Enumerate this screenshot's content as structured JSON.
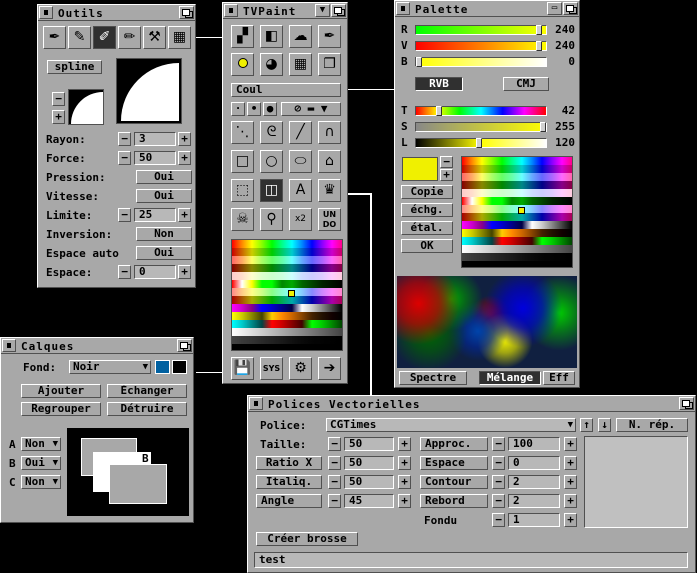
{
  "outils": {
    "title": "Outils",
    "spline": "spline",
    "rayon_label": "Rayon:",
    "rayon_value": "3",
    "force_label": "Force:",
    "force_value": "50",
    "pression_label": "Pression:",
    "pression_value": "Oui",
    "vitesse_label": "Vitesse:",
    "vitesse_value": "Oui",
    "limite_label": "Limite:",
    "limite_value": "25",
    "inversion_label": "Inversion:",
    "inversion_value": "Non",
    "espace_auto_label": "Espace auto",
    "espace_auto_value": "Oui",
    "espace_label": "Espace:",
    "espace_value": "0",
    "minus": "−",
    "plus": "+",
    "plus_small": "+",
    "minus_small": "−"
  },
  "tvpaint": {
    "title": "TVPaint",
    "coul": "Coul",
    "undo": "UN DO",
    "sys": "SYS"
  },
  "palette": {
    "title": "Palette",
    "r_label": "R",
    "r_value": "240",
    "v_label": "V",
    "v_value": "240",
    "b_label": "B",
    "b_value": "0",
    "rvb": "RVB",
    "cmj": "CMJ",
    "t_label": "T",
    "t_value": "42",
    "s_label": "S",
    "s_value": "255",
    "l_label": "L",
    "l_value": "120",
    "copie": "Copie",
    "echg": "échg.",
    "etal": "étal.",
    "ok": "OK",
    "spectre": "Spectre",
    "melange": "Mélange",
    "eff": "Eff",
    "current_color": "#f0f000",
    "r_fraction": 0.94,
    "v_fraction": 0.94,
    "b_fraction": 0.0,
    "t_fraction": 0.16,
    "s_fraction": 1.0,
    "l_fraction": 0.47
  },
  "calques": {
    "title": "Calques",
    "fond_label": "Fond:",
    "fond_value": "Noir",
    "ajouter": "Ajouter",
    "echanger": "Échanger",
    "regrouper": "Regrouper",
    "detruire": "Détruire",
    "layers": [
      {
        "letter": "A",
        "value": "Non"
      },
      {
        "letter": "B",
        "value": "Oui"
      },
      {
        "letter": "C",
        "value": "Non"
      }
    ],
    "preview_label": "B"
  },
  "polices": {
    "title": "Polices Vectorielles",
    "police_label": "Police:",
    "police_value": "CGTimes",
    "n_rep": "N. rép.",
    "taille_label": "Taille:",
    "taille_value": "50",
    "ratio_label": "Ratio X",
    "ratio_value": "50",
    "italiq_label": "Italiq.",
    "italiq_value": "50",
    "angle_label": "Angle",
    "angle_value": "45",
    "approc_label": "Approc.",
    "approc_value": "100",
    "espace_label": "Espace",
    "espace_value": "0",
    "contour_label": "Contour",
    "contour_value": "2",
    "rebord_label": "Rebord",
    "rebord_value": "2",
    "fondu_label": "Fondu",
    "fondu_value": "1",
    "creer_brosse": "Créer brosse",
    "text_value": "test",
    "minus": "−",
    "plus": "+"
  }
}
